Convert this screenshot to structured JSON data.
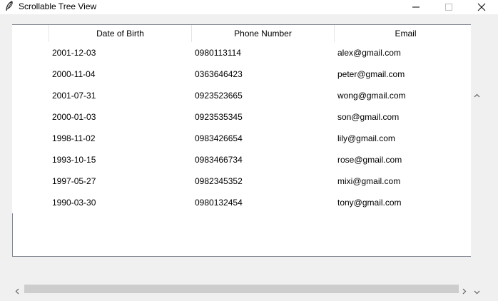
{
  "window": {
    "title": "Scrollable Tree View",
    "icon": "feather-icon"
  },
  "table": {
    "columns": [
      "",
      "Date of Birth",
      "Phone Number",
      "Email"
    ],
    "rows": [
      {
        "dob": "2001-12-03",
        "phone": "0980113114",
        "email": "alex@gmail.com"
      },
      {
        "dob": "2000-11-04",
        "phone": "0363646423",
        "email": "peter@gmail.com"
      },
      {
        "dob": "2001-07-31",
        "phone": "0923523665",
        "email": "wong@gmail.com"
      },
      {
        "dob": "2000-01-03",
        "phone": "0923535345",
        "email": "son@gmail.com"
      },
      {
        "dob": "1998-11-02",
        "phone": "0983426654",
        "email": "lily@gmail.com"
      },
      {
        "dob": "1993-10-15",
        "phone": "0983466734",
        "email": "rose@gmail.com"
      },
      {
        "dob": "1997-05-27",
        "phone": "0982345352",
        "email": "mixi@gmail.com"
      },
      {
        "dob": "1990-03-30",
        "phone": "0980132454",
        "email": "tony@gmail.com"
      }
    ]
  },
  "scrollbars": {
    "horizontal": {
      "left_arrow": "‹",
      "right_arrow": "›"
    },
    "vertical": {
      "up_arrow": "˄",
      "down_arrow": "˅"
    }
  },
  "colors": {
    "thumb": "#cdcdcd",
    "background": "#f0f0f0"
  }
}
